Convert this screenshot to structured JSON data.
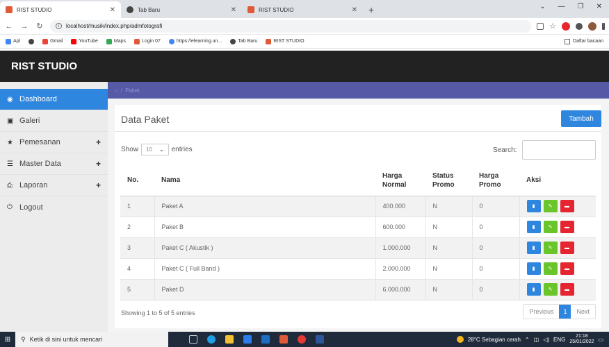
{
  "browser": {
    "tabs": [
      {
        "title": "RIST STUDIO",
        "icon": "rist-favicon",
        "active": true
      },
      {
        "title": "Tab Baru",
        "icon": "globe-favicon",
        "active": false
      },
      {
        "title": "RIST STUDIO",
        "icon": "rist-favicon",
        "active": false
      }
    ],
    "new_tab": "+",
    "url": "localhost/musik/index.php/admfotografi",
    "bookmarks": [
      {
        "label": "Apl",
        "color": "#4285f4"
      },
      {
        "label": "",
        "color": "#444444"
      },
      {
        "label": "Gmail",
        "color": "#ea4335"
      },
      {
        "label": "YouTube",
        "color": "#ff0000"
      },
      {
        "label": "Maps",
        "color": "#34a853"
      },
      {
        "label": "Login 07",
        "color": "#e05a3a"
      },
      {
        "label": "https://elearning.un...",
        "color": "#4285f4"
      },
      {
        "label": "Tab Baru",
        "color": "#444444"
      },
      {
        "label": "RIST STUDIO",
        "color": "#e05a3a"
      }
    ],
    "reading_list": "Daftar bacaan"
  },
  "app": {
    "brand": "RIST STUDIO",
    "breadcrumb": {
      "home_icon": "home-icon",
      "separator": "/",
      "current": "Paket"
    }
  },
  "sidebar": {
    "items": [
      {
        "label": "Dashboard",
        "icon": "dashboard-icon",
        "active": true,
        "expandable": false
      },
      {
        "label": "Galeri",
        "icon": "image-icon",
        "active": false,
        "expandable": false
      },
      {
        "label": "Pemesanan",
        "icon": "star-icon",
        "active": false,
        "expandable": true
      },
      {
        "label": "Master Data",
        "icon": "database-icon",
        "active": false,
        "expandable": true
      },
      {
        "label": "Laporan",
        "icon": "print-icon",
        "active": false,
        "expandable": true
      },
      {
        "label": "Logout",
        "icon": "power-icon",
        "active": false,
        "expandable": false
      }
    ],
    "plus": "+"
  },
  "main": {
    "title": "Data Paket",
    "add_button": "Tambah",
    "show_label": "Show",
    "entries_value": "10",
    "entries_label": "entries",
    "search_label": "Search:",
    "search_value": "",
    "table": {
      "headers": [
        "No.",
        "Nama",
        "Harga Normal",
        "Status Promo",
        "Harga Promo",
        "Aksi"
      ],
      "rows": [
        {
          "no": "1",
          "nama": "Paket A",
          "harga": "400.000",
          "status": "N",
          "promo": "0"
        },
        {
          "no": "2",
          "nama": "Paket B",
          "harga": "600.000",
          "status": "N",
          "promo": "0"
        },
        {
          "no": "3",
          "nama": "Paket C ( Akustik )",
          "harga": "1.000.000",
          "status": "N",
          "promo": "0"
        },
        {
          "no": "4",
          "nama": "Paket C ( Full Band )",
          "harga": "2.000.000",
          "status": "N",
          "promo": "0"
        },
        {
          "no": "5",
          "nama": "Paket D",
          "harga": "6.000.000",
          "status": "N",
          "promo": "0"
        }
      ]
    },
    "info": "Showing 1 to 5 of 5 entries",
    "pagination": {
      "previous": "Previous",
      "current": "1",
      "next": "Next"
    }
  },
  "taskbar": {
    "search_placeholder": "Ketik di sini untuk mencari",
    "weather": "28°C  Sebagian cerah",
    "language": "ENG",
    "time": "21:18",
    "date": "25/01/2022"
  }
}
